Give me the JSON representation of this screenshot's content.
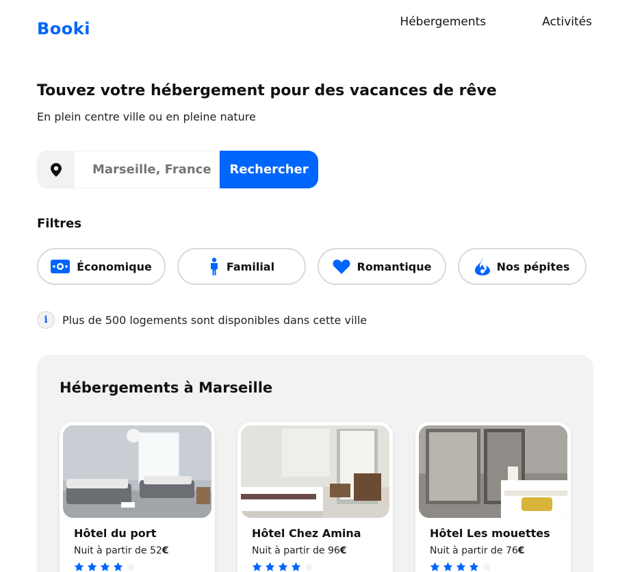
{
  "header": {
    "logo": "Booki",
    "nav": [
      {
        "label": "Hébergements"
      },
      {
        "label": "Activités"
      }
    ]
  },
  "hero": {
    "title": "Touvez votre hébergement pour des vacances de rêve",
    "subtitle": "En plein centre ville ou en pleine nature"
  },
  "search": {
    "placeholder": "Marseille, France",
    "button_label": "Rechercher"
  },
  "filters": {
    "title": "Filtres",
    "items": [
      {
        "label": "Économique",
        "icon": "money-icon"
      },
      {
        "label": "Familial",
        "icon": "child-icon"
      },
      {
        "label": "Romantique",
        "icon": "heart-icon"
      },
      {
        "label": "Nos pépites",
        "icon": "fire-icon"
      }
    ]
  },
  "info": {
    "text": "Plus de 500 logements sont disponibles dans cette ville"
  },
  "listings": {
    "title": "Hébergements à Marseille",
    "items": [
      {
        "name": "Hôtel du port",
        "price_prefix": "Nuit à partir de 52",
        "currency": "€",
        "rating": 4
      },
      {
        "name": "Hôtel Chez Amina",
        "price_prefix": "Nuit à partir de 96",
        "currency": "€",
        "rating": 4
      },
      {
        "name": "Hôtel Les mouettes",
        "price_prefix": "Nuit à partir de 76",
        "currency": "€",
        "rating": 4
      }
    ]
  },
  "colors": {
    "accent": "#0065FC",
    "star_off": "#F2F2F2",
    "background_section": "#F2F2F2"
  }
}
